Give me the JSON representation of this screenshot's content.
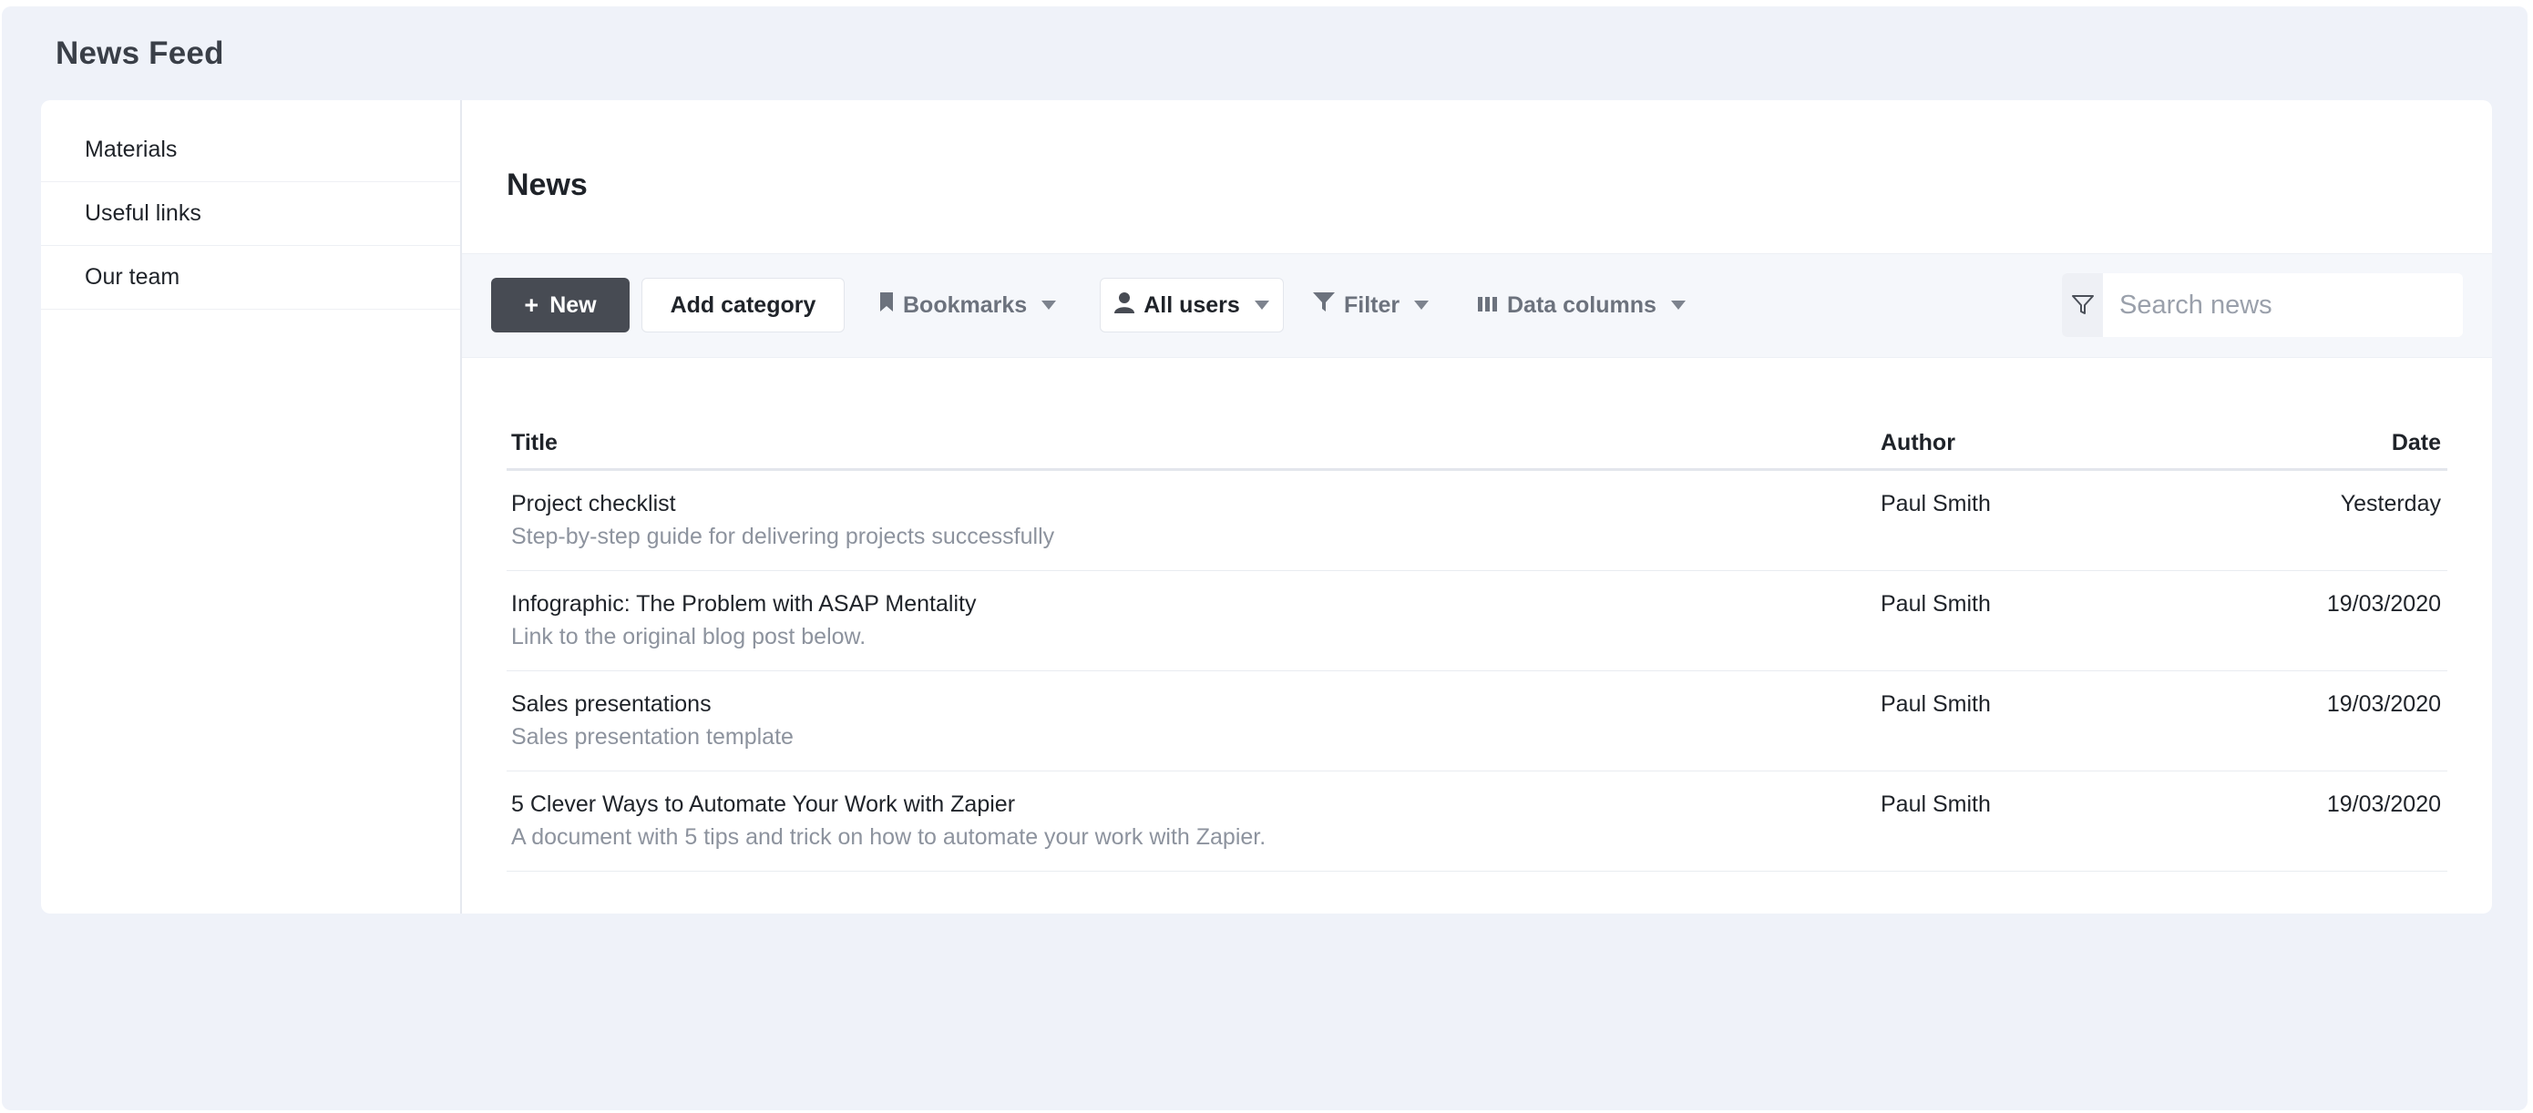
{
  "app": {
    "title": "News Feed"
  },
  "sidebar": {
    "items": [
      {
        "label": "Materials"
      },
      {
        "label": "Useful links"
      },
      {
        "label": "Our team"
      }
    ]
  },
  "main": {
    "title": "News",
    "toolbar": {
      "new_label": "New",
      "add_category_label": "Add category",
      "bookmarks_label": "Bookmarks",
      "users_label": "All users",
      "filter_label": "Filter",
      "columns_label": "Data columns",
      "search_placeholder": "Search news"
    },
    "table": {
      "columns": {
        "title": "Title",
        "author": "Author",
        "date": "Date"
      },
      "rows": [
        {
          "title": "Project checklist",
          "subtitle": "Step-by-step guide for delivering projects successfully",
          "author": "Paul Smith",
          "date": "Yesterday"
        },
        {
          "title": "Infographic: The Problem with ASAP Mentality",
          "subtitle": "Link to the original blog post below.",
          "author": "Paul Smith",
          "date": "19/03/2020"
        },
        {
          "title": "Sales presentations",
          "subtitle": "Sales presentation template",
          "author": "Paul Smith",
          "date": "19/03/2020"
        },
        {
          "title": "5 Clever Ways to Automate Your Work with Zapier",
          "subtitle": "A document with 5 tips and trick on how to automate your work with Zapier.",
          "author": "Paul Smith",
          "date": "19/03/2020"
        }
      ]
    }
  },
  "icons": {
    "new": "plus-icon",
    "bookmarks": "bookmark-icon",
    "users": "user-icon",
    "filter": "funnel-icon",
    "columns": "columns-icon",
    "search": "funnel-outline-icon",
    "dropdown": "caret-down-icon"
  },
  "colors": {
    "background": "#eff2f9",
    "primary_button": "#474b53",
    "muted_text": "#8d939e"
  }
}
